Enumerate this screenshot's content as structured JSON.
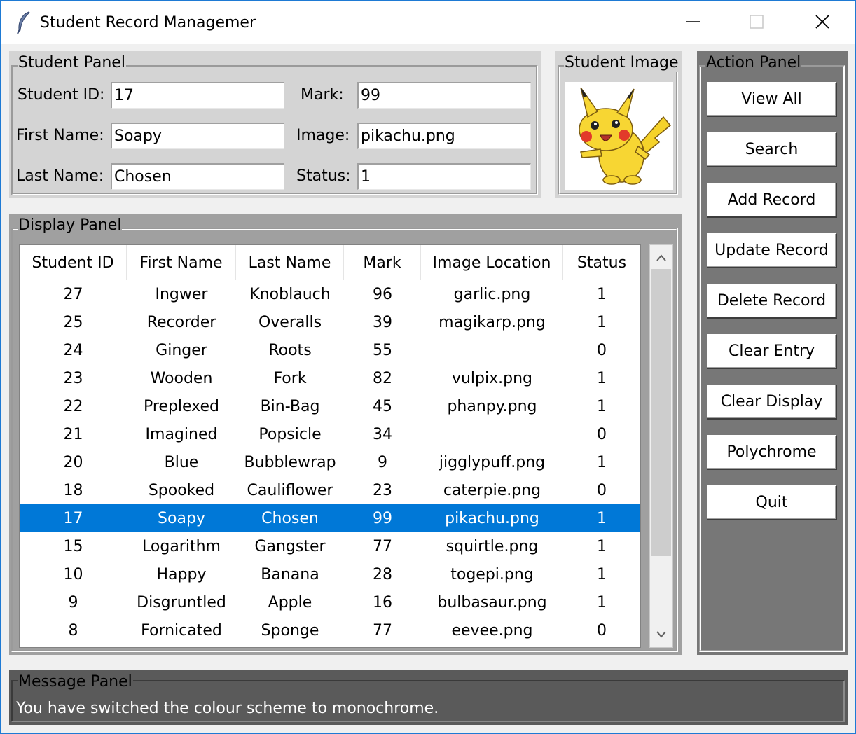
{
  "window": {
    "title": "Student Record Managemer",
    "icon": "feather-icon"
  },
  "student_panel": {
    "title": "Student Panel",
    "student_id_label": "Student ID:",
    "student_id_value": "17",
    "first_name_label": "First Name:",
    "first_name_value": "Soapy",
    "last_name_label": "Last Name:",
    "last_name_value": "Chosen",
    "mark_label": "Mark:",
    "mark_value": "99",
    "image_label": "Image:",
    "image_value": "pikachu.png",
    "status_label": "Status:",
    "status_value": "1"
  },
  "image_panel": {
    "title": "Student Image",
    "image": "pikachu-image"
  },
  "display_panel": {
    "title": "Display Panel",
    "columns": [
      "Student ID",
      "First Name",
      "Last Name",
      "Mark",
      "Image Location",
      "Status"
    ],
    "rows": [
      [
        "27",
        "Ingwer",
        "Knoblauch",
        "96",
        "garlic.png",
        "1"
      ],
      [
        "25",
        "Recorder",
        "Overalls",
        "39",
        "magikarp.png",
        "1"
      ],
      [
        "24",
        "Ginger",
        "Roots",
        "55",
        "",
        "0"
      ],
      [
        "23",
        "Wooden",
        "Fork",
        "82",
        "vulpix.png",
        "1"
      ],
      [
        "22",
        "Preplexed",
        "Bin-Bag",
        "45",
        "phanpy.png",
        "1"
      ],
      [
        "21",
        "Imagined",
        "Popsicle",
        "34",
        "",
        "0"
      ],
      [
        "20",
        "Blue",
        "Bubblewrap",
        "9",
        "jigglypuff.png",
        "1"
      ],
      [
        "18",
        "Spooked",
        "Cauliflower",
        "23",
        "caterpie.png",
        "0"
      ],
      [
        "17",
        "Soapy",
        "Chosen",
        "99",
        "pikachu.png",
        "1"
      ],
      [
        "15",
        "Logarithm",
        "Gangster",
        "77",
        "squirtle.png",
        "1"
      ],
      [
        "10",
        "Happy",
        "Banana",
        "28",
        "togepi.png",
        "1"
      ],
      [
        "9",
        "Disgruntled",
        "Apple",
        "16",
        "bulbasaur.png",
        "1"
      ],
      [
        "8",
        "Fornicated",
        "Sponge",
        "77",
        "eevee.png",
        "0"
      ]
    ],
    "selected_row": 8
  },
  "action_panel": {
    "title": "Action Panel",
    "buttons": [
      "View All",
      "Search",
      "Add Record",
      "Update Record",
      "Delete Record",
      "Clear Entry",
      "Clear Display",
      "Polychrome",
      "Quit"
    ]
  },
  "message_panel": {
    "title": "Message Panel",
    "message": "You have switched the colour scheme to monochrome."
  },
  "colors": {
    "student_panel_bg": "#d4d4d4",
    "display_panel_bg": "#a0a0a0",
    "action_panel_bg": "#777777",
    "message_panel_bg": "#5a5a5a",
    "selection": "#0078d7"
  }
}
